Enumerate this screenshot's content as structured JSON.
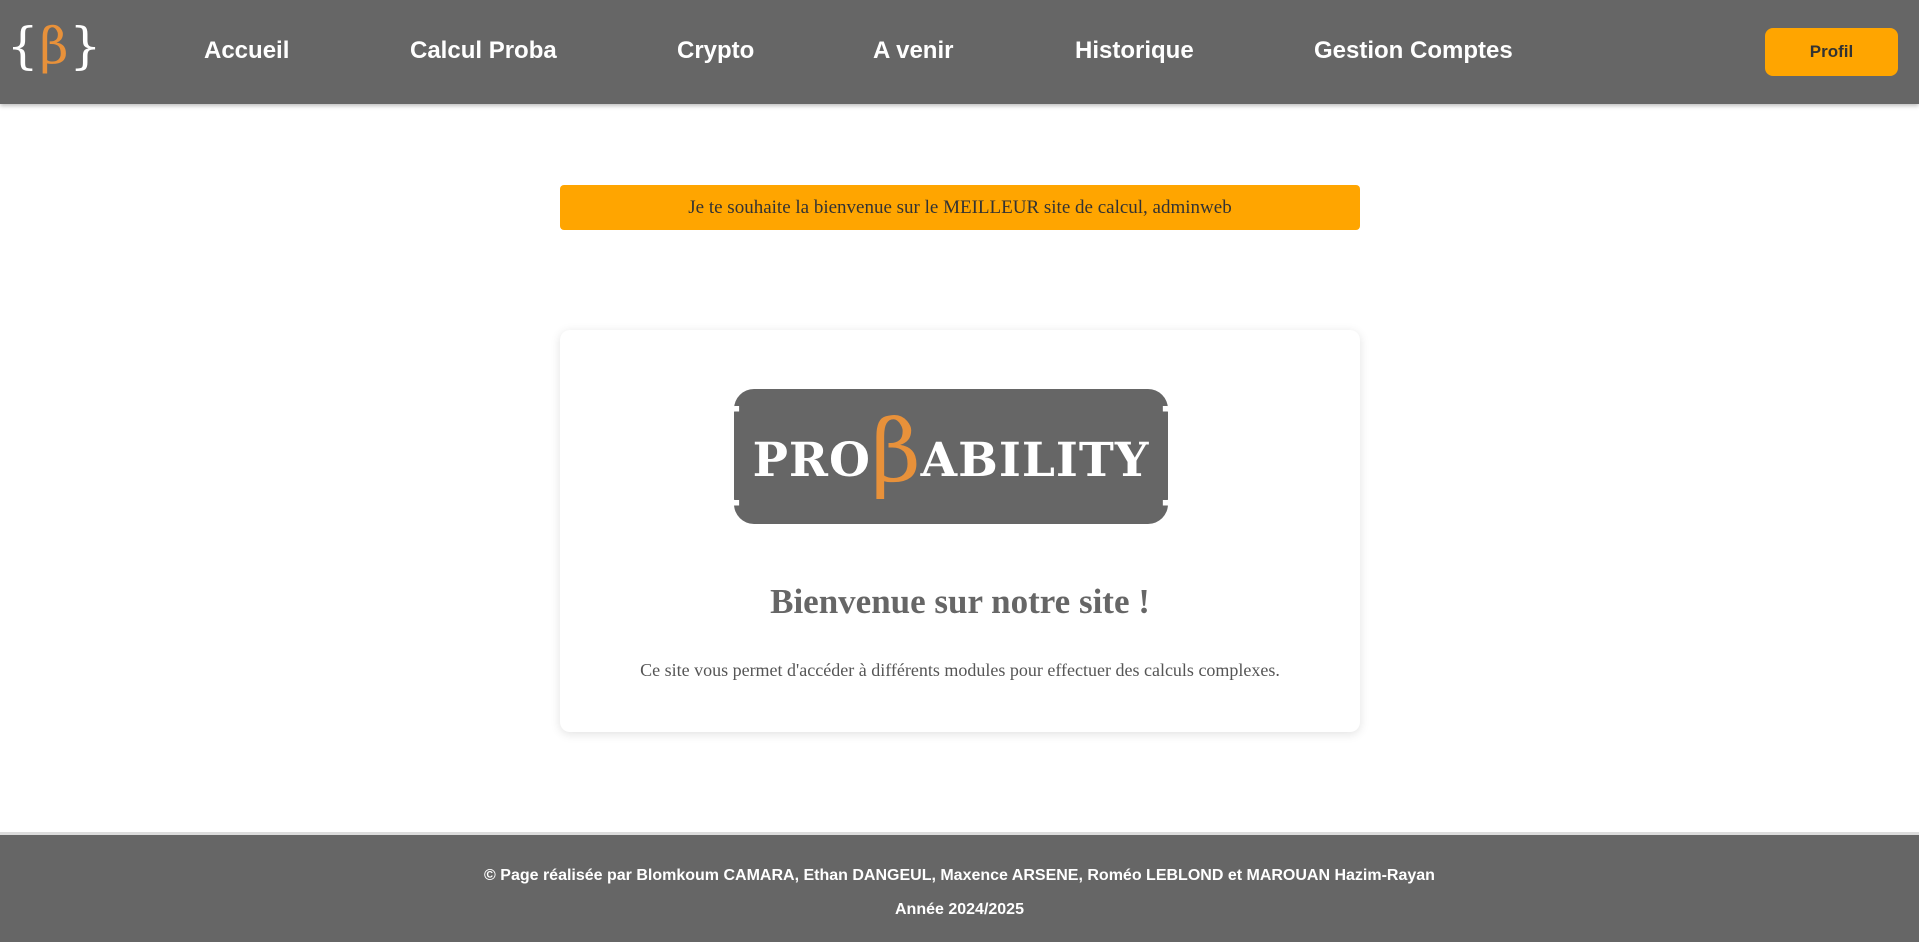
{
  "navbar": {
    "logo": {
      "brace_open": "{",
      "symbol": "β",
      "brace_close": "}"
    },
    "links": [
      {
        "label": "Accueil"
      },
      {
        "label": "Calcul Proba"
      },
      {
        "label": "Crypto"
      },
      {
        "label": "A venir"
      },
      {
        "label": "Historique"
      },
      {
        "label": "Gestion Comptes"
      }
    ],
    "profile_label": "Profil"
  },
  "banner": {
    "text": "Je te souhaite la bienvenue sur le MEILLEUR site de calcul, adminweb"
  },
  "card": {
    "logo": {
      "brace_open": "{",
      "part1": "PRO",
      "symbol": "β",
      "part2": "ABILITY",
      "brace_close": "}"
    },
    "title": "Bienvenue sur notre site !",
    "text": "Ce site vous permet d'accéder à différents modules pour effectuer des calculs complexes."
  },
  "footer": {
    "credits": "© Page réalisée par Blomkoum CAMARA, Ethan DANGEUL, Maxence ARSENE, Roméo LEBLOND et MAROUAN Hazim-Rayan",
    "year": "Année 2024/2025"
  },
  "colors": {
    "navbar_bg": "#666666",
    "accent": "#ffa500",
    "logo_beta": "#e8913a",
    "footer_bg": "#666666"
  }
}
